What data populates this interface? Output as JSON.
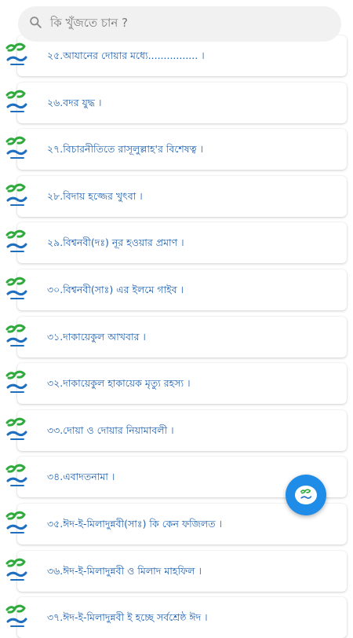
{
  "search": {
    "placeholder": "কি খুঁজতে চান ?"
  },
  "items": [
    {
      "label": "২৫.আযানের দোয়ার মধ্যে................  ।"
    },
    {
      "label": "২৬.বদর যুদ্ধ ।"
    },
    {
      "label": "২৭.বিচারনীতিতে রাসূলুল্লাহ'র বিশেষত্ব ।"
    },
    {
      "label": "২৮.বিদায় হজ্জের খুৎবা ।"
    },
    {
      "label": "২৯.বিশ্বনবী(দঃ) নূর হওয়ার প্রমাণ ।"
    },
    {
      "label": "৩০.বিশ্বনবী(সাঃ) এর ইলমে গাইব ।"
    },
    {
      "label": "৩১.দাকায়েকুল আখবার ।"
    },
    {
      "label": "৩২.দাকায়েকুল হাকায়েক মৃত্যু রহস্য ।"
    },
    {
      "label": "৩৩.দোয়া ও দোয়ার নিয়ামাবলী ।"
    },
    {
      "label": "৩৪.এবাদতনামা ।"
    },
    {
      "label": "৩৫.ঈদ-ই-মিলাদুন্নবী(সাঃ) কি কেন ফজিলত  ।"
    },
    {
      "label": "৩৬.ঈদ-ই-মিলাদুন্নবী ও মিলাদ মাহফিল ।"
    },
    {
      "label": "৩৭.ঈদ-ই-মিলাদুন্নবী ই হচ্ছে সর্বশ্রেষ্ঠ ঈদ ।"
    }
  ],
  "icons": {
    "search": "search-icon",
    "row_logo": "book-logo-icon",
    "fab": "book-logo-icon"
  },
  "colors": {
    "item_text": "#1f62b0",
    "logo_green": "#2faa3c",
    "logo_blue": "#1f6fc0",
    "fab": "#1f8de8"
  }
}
